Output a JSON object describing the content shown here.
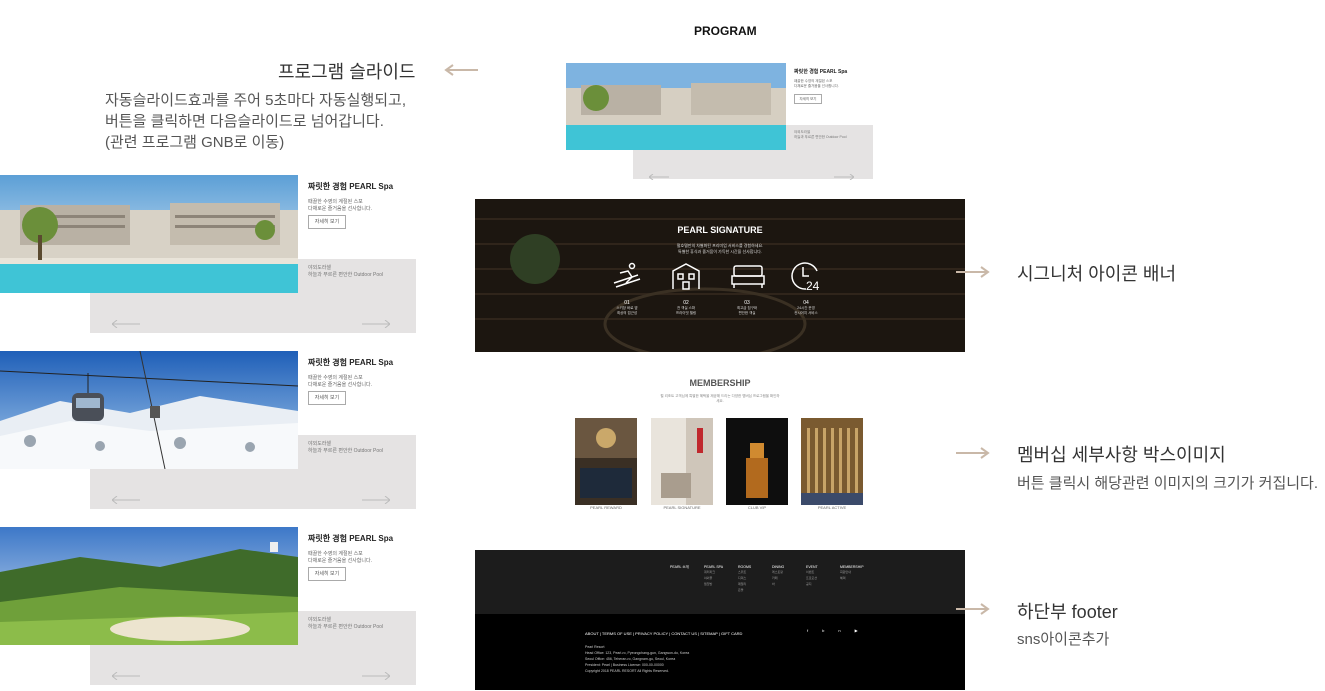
{
  "program": {
    "heading": "PROGRAM"
  },
  "slide_desc": {
    "title": "프로그램 슬라이드",
    "line1": "자동슬라이드효과를 주어 5초마다 자동실행되고,",
    "line2": "버튼을 클릭하면 다음슬라이드로 넘어갑니다.",
    "line3": "(관련 프로그램 GNB로 이동)"
  },
  "slides": [
    {
      "title": "짜릿한 경험 PEARL Spa",
      "sub1": "때끌한 수영의 계절된 스포",
      "sub2": "다채로운 즐거움을 선사합니다.",
      "more": "자세히 보기",
      "note1": "야외도라셀",
      "note2": "하늘과 푸르른 편안한 Outdoor Pool"
    },
    {
      "title": "짜릿한 경험 PEARL Spa",
      "sub1": "때끌한 수영의 계절된 스포",
      "sub2": "다채로운 즐거움을 선사합니다.",
      "more": "자세히 보기",
      "note1": "야외도라셀",
      "note2": "하늘과 푸르른 편안한 Outdoor Pool"
    },
    {
      "title": "짜릿한 경험 PEARL Spa",
      "sub1": "때끌한 수영의 계절된 스포",
      "sub2": "다채로운 즐거움을 선사합니다.",
      "more": "자세히 보기",
      "note1": "야외도라셀",
      "note2": "하늘과 푸르른 편안한 Outdoor Pool"
    }
  ],
  "mini": {
    "title": "짜릿한 경험 PEARL Spa",
    "sub1": "때끌한 수영의 계절된 스포",
    "sub2": "다채로운 즐거움을 선사합니다.",
    "more": "자세히 보기",
    "note1": "야외도라셀",
    "note2": "하늘과 푸르른 편안한 Outdoor Pool"
  },
  "signature": {
    "title": "PEARL SIGNATURE",
    "text1": "펄호텔만의 차별화된 프리미엄 서비스를 경험하세요.",
    "text2": "특별한 휴식과 즐거움이 가득한 시간을 선사합니다.",
    "items": [
      {
        "num": "01",
        "t1": "스키장 바로 옆",
        "t2": "최상의 접근성"
      },
      {
        "num": "02",
        "t1": "전 객실 스파",
        "t2": "프라이빗 힐링"
      },
      {
        "num": "03",
        "t1": "최고급 침구와",
        "t2": "편안한 객실"
      },
      {
        "num": "04",
        "t1": "24시간 운영",
        "t2": "컨시어지 서비스"
      }
    ]
  },
  "signature_desc": {
    "title": "시그니처 아이콘 배너"
  },
  "membership": {
    "heading": "MEMBERSHIP",
    "text": "펄 리조트 고객님께 특별한 혜택을 제공해 드리는 다양한 멤버십 프로그램을 확인하세요.",
    "cards": [
      "PEARL REWARD",
      "PEARL SIGNATURE",
      "CLUB VIP",
      "PEARL ACTIVE"
    ]
  },
  "membership_desc": {
    "title": "멤버십 세부사항 박스이미지",
    "body": "버튼 클릭시 해당관련 이미지의 크기가 커집니다."
  },
  "footer": {
    "cols": [
      {
        "h": "PEARL 소개",
        "items": []
      },
      {
        "h": "PEARL SPA",
        "items": [
          "워터파크",
          "야외풀",
          "찜질방"
        ]
      },
      {
        "h": "ROOMS",
        "items": [
          "스위트",
          "디럭스",
          "패밀리",
          "온돌"
        ]
      },
      {
        "h": "DINING",
        "items": [
          "레스토랑",
          "카페",
          "바"
        ]
      },
      {
        "h": "EVENT",
        "items": [
          "이벤트",
          "프로모션",
          "공지"
        ]
      },
      {
        "h": "MEMBERSHIP",
        "items": [
          "회원안내",
          "혜택"
        ]
      }
    ],
    "links": "ABOUT | TERMS OF USE | PRIVACY POLICY | CONTACT US | SITEMAP | GIFT CARD",
    "addr1": "Pearl Resort",
    "addr2": "Head Office: 123, Pearl-ro, Pyeongchang-gun, Gangwon-do, Korea",
    "addr3": "Seoul Office: 456, Teheran-ro, Gangnam-gu, Seoul, Korea",
    "addr4": "President: Pearl | Business License: 000-00-00000",
    "addr5": "Copyright 2018 PEARL RESORT All Rights Reserved."
  },
  "footer_desc": {
    "title": "하단부 footer",
    "body": "sns아이콘추가"
  },
  "colors": {
    "arrow": "#c9b8a8",
    "grey": "#e5e3e3",
    "dark": "#000000"
  }
}
